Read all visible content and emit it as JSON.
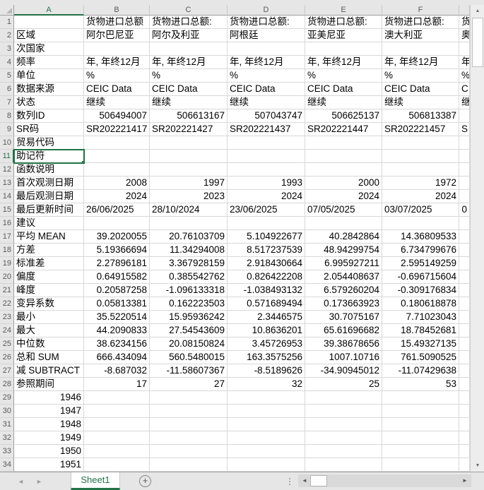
{
  "sheet": {
    "name": "Sheet1",
    "column_headers": [
      "A",
      "B",
      "C",
      "D",
      "E",
      "F"
    ],
    "selected": {
      "cell": "A11",
      "column": "A",
      "row": 11
    },
    "rows": [
      {
        "n": 1,
        "cells": [
          "",
          "货物进口总额",
          "货物进口总额:",
          "货物进口总额:",
          "货物进口总额:",
          "货物进口总额:",
          "货"
        ]
      },
      {
        "n": 2,
        "cells": [
          "区域",
          "阿尔巴尼亚",
          "阿尔及利亚",
          "阿根廷",
          "亚美尼亚",
          "澳大利亚",
          "奥"
        ]
      },
      {
        "n": 3,
        "cells": [
          "次国家",
          "",
          "",
          "",
          "",
          "",
          ""
        ]
      },
      {
        "n": 4,
        "cells": [
          "频率",
          "年, 年终12月",
          "年, 年终12月",
          "年, 年终12月",
          "年, 年终12月",
          "年, 年终12月",
          "年"
        ]
      },
      {
        "n": 5,
        "cells": [
          "单位",
          "%",
          "%",
          "%",
          "%",
          "%",
          "%"
        ]
      },
      {
        "n": 6,
        "cells": [
          "数据来源",
          "CEIC Data",
          "CEIC Data",
          "CEIC Data",
          "CEIC Data",
          "CEIC Data",
          "C"
        ]
      },
      {
        "n": 7,
        "cells": [
          "状态",
          "继续",
          "继续",
          "继续",
          "继续",
          "继续",
          "继"
        ]
      },
      {
        "n": 8,
        "cells": [
          "数列ID",
          "506494007",
          "506613167",
          "507043747",
          "506625137",
          "506813387",
          ""
        ]
      },
      {
        "n": 9,
        "cells": [
          "SR码",
          "SR202221417",
          "SR202221427",
          "SR202221437",
          "SR202221447",
          "SR202221457",
          "S"
        ]
      },
      {
        "n": 10,
        "cells": [
          "贸易代码",
          "",
          "",
          "",
          "",
          "",
          ""
        ]
      },
      {
        "n": 11,
        "cells": [
          "助记符",
          "",
          "",
          "",
          "",
          "",
          ""
        ]
      },
      {
        "n": 12,
        "cells": [
          "函数说明",
          "",
          "",
          "",
          "",
          "",
          ""
        ]
      },
      {
        "n": 13,
        "cells": [
          "首次观测日期",
          "2008",
          "1997",
          "1993",
          "2000",
          "1972",
          ""
        ]
      },
      {
        "n": 14,
        "cells": [
          "最后观测日期",
          "2024",
          "2023",
          "2024",
          "2024",
          "2024",
          ""
        ]
      },
      {
        "n": 15,
        "cells": [
          "最后更新时间",
          "26/06/2025",
          "28/10/2024",
          "23/06/2025",
          "07/05/2025",
          "03/07/2025",
          "0"
        ]
      },
      {
        "n": 16,
        "cells": [
          "建议",
          "",
          "",
          "",
          "",
          "",
          ""
        ]
      },
      {
        "n": 17,
        "cells": [
          "平均 MEAN",
          "39.2020055",
          "20.76103709",
          "5.104922677",
          "40.2842864",
          "14.36809533",
          ""
        ]
      },
      {
        "n": 18,
        "cells": [
          "方差",
          "5.19366694",
          "11.34294008",
          "8.517237539",
          "48.94299754",
          "6.734799676",
          ""
        ]
      },
      {
        "n": 19,
        "cells": [
          "标准差",
          "2.27896181",
          "3.367928159",
          "2.918430664",
          "6.995927211",
          "2.595149259",
          ""
        ]
      },
      {
        "n": 20,
        "cells": [
          "偏度",
          "0.64915582",
          "0.385542762",
          "0.826422208",
          "2.054408637",
          "-0.696715604",
          ""
        ]
      },
      {
        "n": 21,
        "cells": [
          "峰度",
          "0.20587258",
          "-1.096133318",
          "-1.038493132",
          "6.579260204",
          "-0.309176834",
          ""
        ]
      },
      {
        "n": 22,
        "cells": [
          "变异系数",
          "0.05813381",
          "0.162223503",
          "0.571689494",
          "0.173663923",
          "0.180618878",
          ""
        ]
      },
      {
        "n": 23,
        "cells": [
          "最小",
          "35.5220514",
          "15.95936242",
          "2.3446575",
          "30.7075167",
          "7.71023043",
          ""
        ]
      },
      {
        "n": 24,
        "cells": [
          "最大",
          "44.2090833",
          "27.54543609",
          "10.8636201",
          "65.61696682",
          "18.78452681",
          ""
        ]
      },
      {
        "n": 25,
        "cells": [
          "中位数",
          "38.6234156",
          "20.08150824",
          "3.45726953",
          "39.38678656",
          "15.49327135",
          ""
        ]
      },
      {
        "n": 26,
        "cells": [
          "总和 SUM",
          "666.434094",
          "560.5480015",
          "163.3575256",
          "1007.10716",
          "761.5090525",
          ""
        ]
      },
      {
        "n": 27,
        "cells": [
          "减 SUBTRACT",
          "-8.687032",
          "-11.58607367",
          "-8.5189626",
          "-34.90945012",
          "-11.07429638",
          ""
        ]
      },
      {
        "n": 28,
        "cells": [
          "参照期间",
          "17",
          "27",
          "32",
          "25",
          "53",
          ""
        ]
      },
      {
        "n": 29,
        "cells": [
          "1946",
          "",
          "",
          "",
          "",
          "",
          ""
        ]
      },
      {
        "n": 30,
        "cells": [
          "1947",
          "",
          "",
          "",
          "",
          "",
          ""
        ]
      },
      {
        "n": 31,
        "cells": [
          "1948",
          "",
          "",
          "",
          "",
          "",
          ""
        ]
      },
      {
        "n": 32,
        "cells": [
          "1949",
          "",
          "",
          "",
          "",
          "",
          ""
        ]
      },
      {
        "n": 33,
        "cells": [
          "1950",
          "",
          "",
          "",
          "",
          "",
          ""
        ]
      },
      {
        "n": 34,
        "cells": [
          "1951",
          "",
          "",
          "",
          "",
          "",
          ""
        ]
      }
    ]
  },
  "tabbar": {
    "sheet_tab_label": "Sheet1",
    "add_sheet_icon": "+",
    "prev_icon": "◄",
    "next_icon": "►"
  },
  "scrollbars": {
    "up_icon": "▲",
    "down_icon": "▼",
    "left_icon": "◄",
    "right_icon": "►"
  },
  "colors": {
    "accent_green": "#217346",
    "header_bg": "#e6e6e6",
    "grid_line": "#d8d8d8"
  }
}
